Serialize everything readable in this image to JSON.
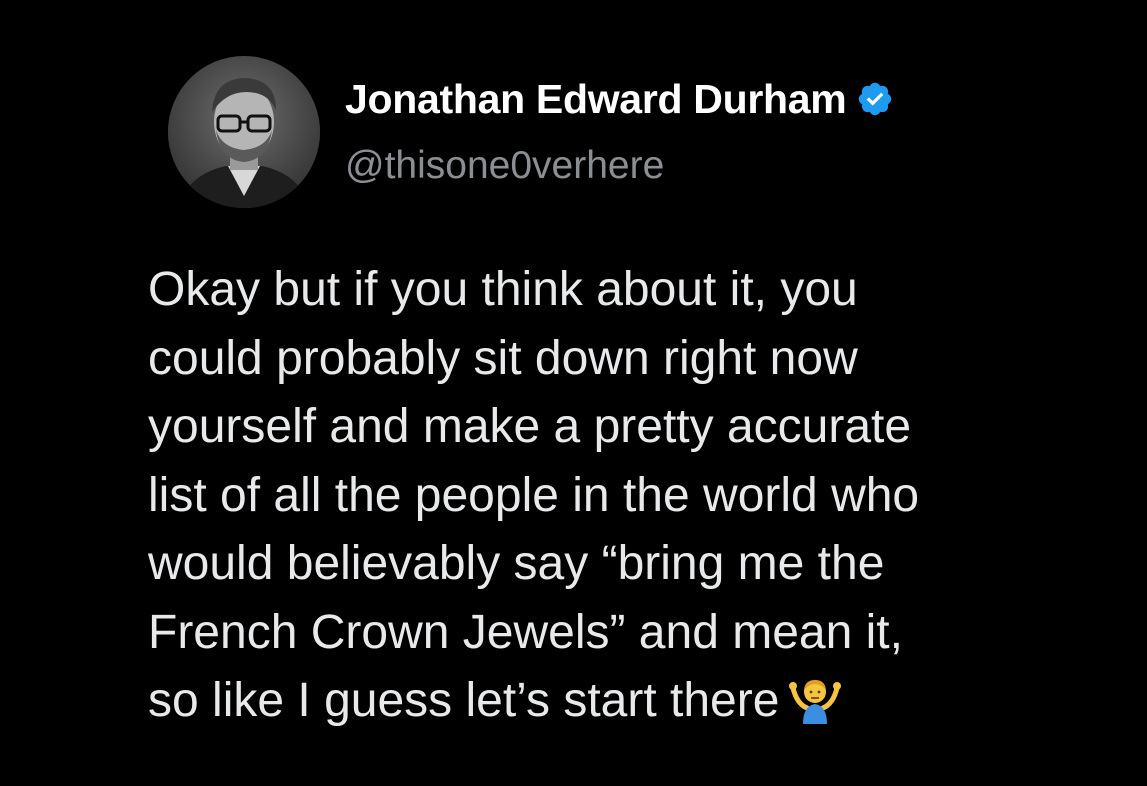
{
  "tweet": {
    "display_name": "Jonathan Edward Durham",
    "handle": "@thisone0verhere",
    "verified_icon": "verified-badge-icon",
    "avatar": "profile-avatar",
    "text_lines": [
      "Okay but if you think about it, you",
      "could probably sit down right now",
      "yourself and make a pretty accurate",
      "list of all the people in the world who",
      "would believably say “bring me the",
      "French Crown Jewels” and mean it,",
      "so like I guess let’s start there"
    ],
    "trailing_emoji": "person-shrugging-emoji"
  },
  "colors": {
    "background": "#000000",
    "name": "#ffffff",
    "handle": "#8b8f94",
    "body": "#e7e9ea",
    "verified": "#1d9bf0"
  }
}
